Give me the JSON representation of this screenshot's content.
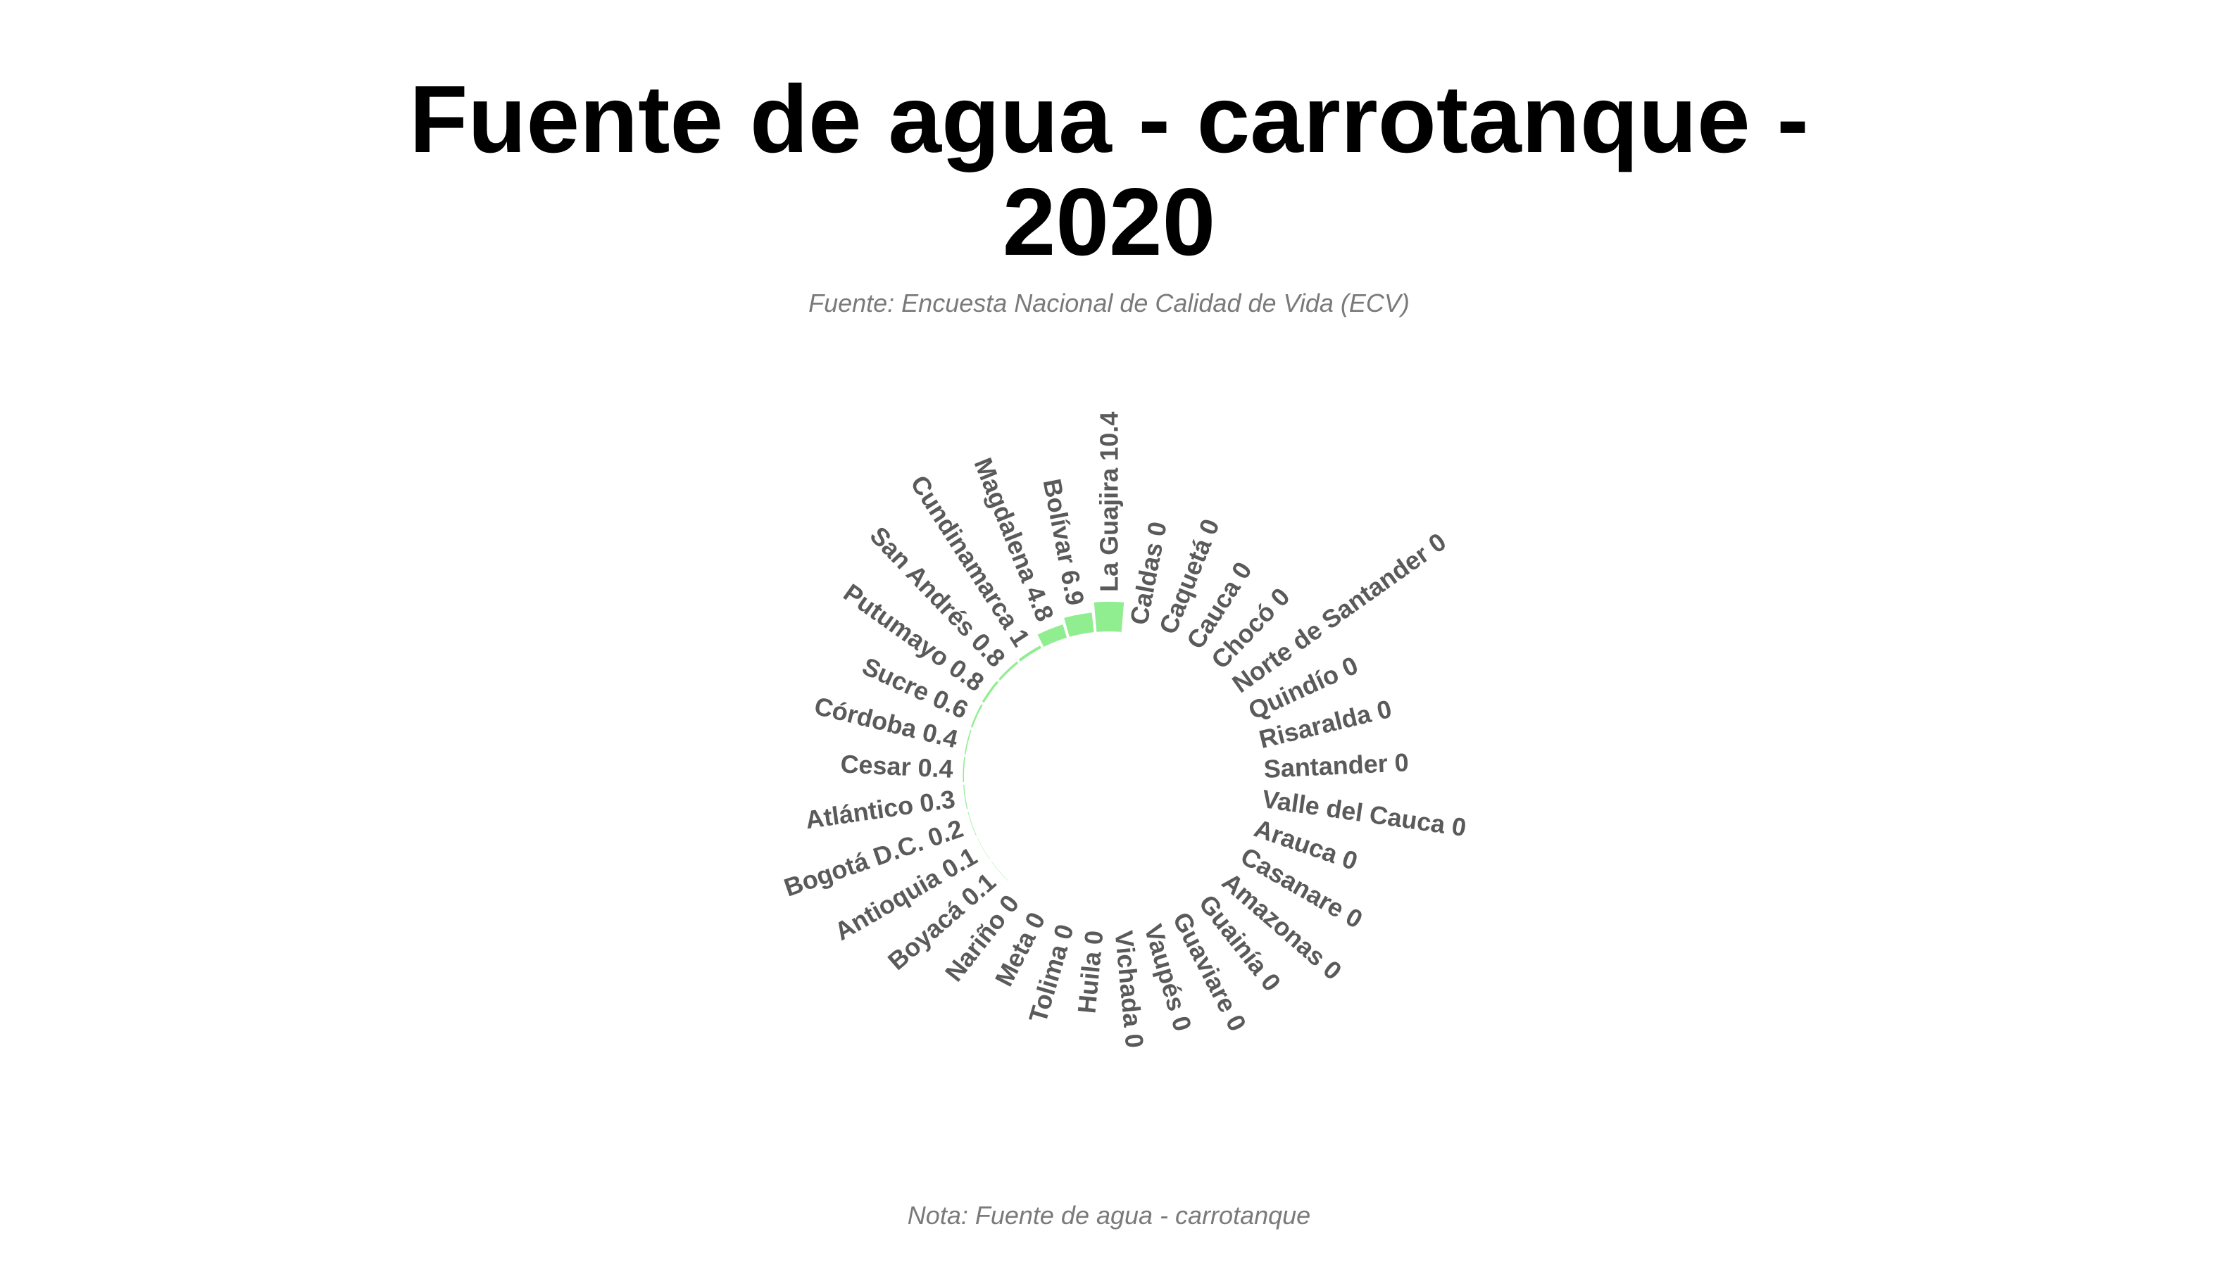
{
  "chart_data": {
    "type": "bar",
    "polar": true,
    "title": "Fuente de agua - carrotanque - 2020",
    "subtitle": "Fuente: Encuesta Nacional de Calidad de Vida (ECV)",
    "caption": "Nota: Fuente de agua - carrotanque",
    "bar_color": "#90EE90",
    "categories": [
      "La Guajira",
      "Caldas",
      "Caquetá",
      "Cauca",
      "Chocó",
      "Norte de Santander",
      "Quindío",
      "Risaralda",
      "Santander",
      "Valle del Cauca",
      "Arauca",
      "Casanare",
      "Amazonas",
      "Guainía",
      "Guaviare",
      "Vaupés",
      "Vichada",
      "Huila",
      "Tolima",
      "Meta",
      "Nariño",
      "Boyacá",
      "Antioquia",
      "Bogotá D.C.",
      "Atlántico",
      "Cesar",
      "Córdoba",
      "Sucre",
      "Putumayo",
      "San Andrés",
      "Cundinamarca",
      "Magdalena",
      "Bolívar"
    ],
    "values": [
      10.4,
      0,
      0,
      0,
      0,
      0,
      0,
      0,
      0,
      0,
      0,
      0,
      0,
      0,
      0,
      0,
      0,
      0,
      0,
      0,
      0,
      0.1,
      0.1,
      0.2,
      0.3,
      0.4,
      0.4,
      0.6,
      0.8,
      0.8,
      1,
      4.8,
      6.9
    ]
  }
}
